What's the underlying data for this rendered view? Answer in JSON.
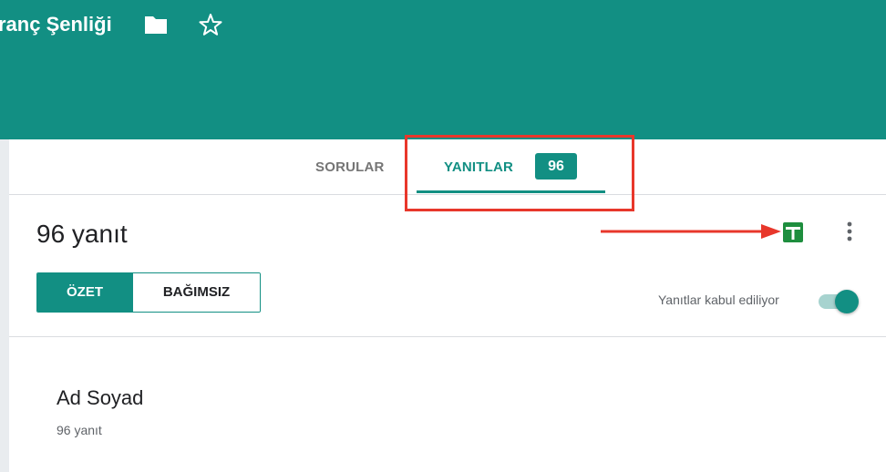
{
  "header": {
    "form_title": "ranç Şenliği",
    "icons": [
      "folder-icon",
      "star-icon"
    ],
    "background_color": "#128f83"
  },
  "tabs": [
    {
      "label": "SORULAR",
      "active": false
    },
    {
      "label": "YANITLAR",
      "active": true,
      "badge": "96"
    }
  ],
  "responses": {
    "title": "96 yanıt",
    "actions": [
      "sheets-icon",
      "more-vert-icon"
    ]
  },
  "view_toggle": {
    "options": [
      "ÖZET",
      "BAĞIMSIZ"
    ],
    "selected": "ÖZET"
  },
  "accepting": {
    "label": "Yanıtlar kabul ediliyor",
    "enabled": true
  },
  "question": {
    "title": "Ad Soyad",
    "count": "96 yanıt"
  },
  "annotations": {
    "color": "#e8372b",
    "items": [
      "highlight-box",
      "arrow"
    ]
  }
}
